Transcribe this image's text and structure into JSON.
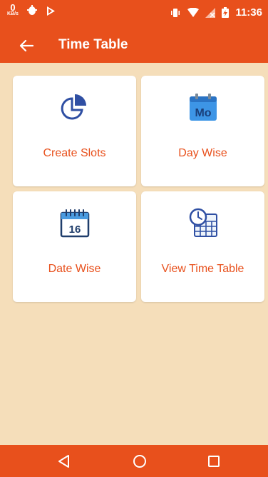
{
  "status_bar": {
    "data_rate_value": "0",
    "data_rate_unit": "KB/s",
    "time": "11:36"
  },
  "app_bar": {
    "title": "Time Table",
    "back_icon": "arrow-left-icon"
  },
  "cards": [
    {
      "label": "Create Slots",
      "icon": "pie-chart-icon"
    },
    {
      "label": "Day Wise",
      "icon": "calendar-mo-icon",
      "icon_text": "Mo"
    },
    {
      "label": "Date Wise",
      "icon": "calendar-16-icon",
      "icon_text": "16"
    },
    {
      "label": "View Time Table",
      "icon": "calendar-clock-icon"
    }
  ],
  "nav_bar": {
    "buttons": [
      "back-triangle-icon",
      "home-circle-icon",
      "recents-square-icon"
    ]
  },
  "colors": {
    "primary": "#e8501c",
    "background": "#f5deba",
    "card": "#ffffff",
    "icon_blue": "#2f4fa3"
  }
}
